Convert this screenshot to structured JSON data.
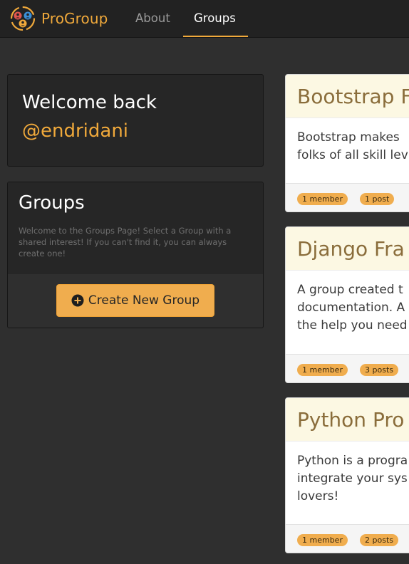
{
  "nav": {
    "brand": "ProGroup",
    "links": [
      {
        "label": "About",
        "active": false
      },
      {
        "label": "Groups",
        "active": true
      }
    ]
  },
  "welcome": {
    "title": "Welcome back",
    "username": "@endridani"
  },
  "groups_panel": {
    "title": "Groups",
    "description": "Welcome to the Groups Page! Select a Group with a shared interest! If you can't find it, you can always create one!",
    "create_button": "Create New Group"
  },
  "groups": [
    {
      "title": "Bootstrap F",
      "body": "Bootstrap makes\nfolks of all skill lev",
      "members": "1 member",
      "posts": "1 post"
    },
    {
      "title": "Django Fra",
      "body": "A group created t\ndocumentation. A\nthe help you need",
      "members": "1 member",
      "posts": "3 posts"
    },
    {
      "title": "Python Pro",
      "body": "Python is a progra\nintegrate your sys\nlovers!",
      "members": "1 member",
      "posts": "2 posts"
    }
  ],
  "colors": {
    "accent": "#f0a93b",
    "navbar": "#222222",
    "background": "#2f2f2f",
    "panel": "#262626",
    "card_header": "#fcf8e3",
    "card_title": "#8a6d3b"
  },
  "icons": [
    "progroup-logo-icon",
    "plus-circle-icon"
  ]
}
